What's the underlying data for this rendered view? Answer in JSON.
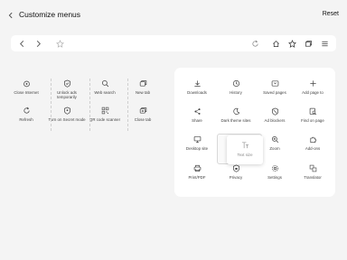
{
  "header": {
    "title": "Customize menus",
    "reset_label": "Reset"
  },
  "toolbar": {
    "left_icons": [
      "back-arrow-icon",
      "forward-arrow-icon",
      "bookmark-star-icon"
    ],
    "right_icons": [
      "reload-icon",
      "home-icon",
      "bookmarks-icon",
      "tabs-icon",
      "menu-icon"
    ]
  },
  "available_items": [
    {
      "label": "Close Internet",
      "icon": "power-icon"
    },
    {
      "label": "Unlock ads temporarily",
      "icon": "shield-icon"
    },
    {
      "label": "Web search",
      "icon": "search-icon"
    },
    {
      "label": "New tab",
      "icon": "new-tab-icon"
    },
    {
      "label": "Refresh",
      "icon": "refresh-icon"
    },
    {
      "label": "Turn on Secret mode",
      "icon": "secret-mode-icon"
    },
    {
      "label": "QR code scanner",
      "icon": "qr-icon"
    },
    {
      "label": "Close tab",
      "icon": "close-tab-icon"
    }
  ],
  "menu_items": [
    {
      "label": "Downloads",
      "icon": "download-icon"
    },
    {
      "label": "History",
      "icon": "history-icon"
    },
    {
      "label": "Saved pages",
      "icon": "saved-pages-icon"
    },
    {
      "label": "Add page to",
      "icon": "plus-icon"
    },
    {
      "label": "Share",
      "icon": "share-icon"
    },
    {
      "label": "Dark theme sites",
      "icon": "moon-icon"
    },
    {
      "label": "Ad blockers",
      "icon": "ad-blocker-icon"
    },
    {
      "label": "Find on page",
      "icon": "find-icon"
    },
    {
      "label": "Desktop site",
      "icon": "desktop-icon"
    },
    {
      "label": "",
      "icon": ""
    },
    {
      "label": "Zoom",
      "icon": "zoom-icon"
    },
    {
      "label": "Add-ons",
      "icon": "addons-icon"
    },
    {
      "label": "Print/PDF",
      "icon": "print-icon"
    },
    {
      "label": "Privacy",
      "icon": "privacy-icon"
    },
    {
      "label": "Settings",
      "icon": "settings-icon"
    },
    {
      "label": "Translator",
      "icon": "translator-icon"
    }
  ],
  "dragging_item": {
    "label": "Text size",
    "icon": "text-size-icon"
  }
}
